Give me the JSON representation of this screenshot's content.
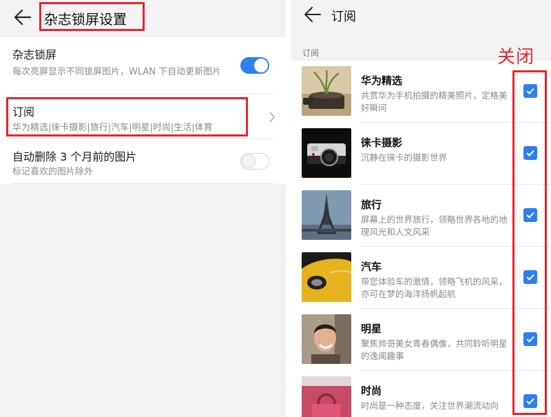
{
  "left": {
    "title": "杂志锁屏设置",
    "settings": [
      {
        "title": "杂志锁屏",
        "subtitle": "每次亮屏显示不同锁屏图片，WLAN 下自动更新图片",
        "toggle": true
      },
      {
        "title": "订阅",
        "subtitle": "华为精选|徕卡摄影|旅行|汽车|明星|时尚|生活|体育"
      },
      {
        "title": "自动删除 3 个月前的图片",
        "subtitle": "标记喜欢的图片除外",
        "toggle": false
      }
    ]
  },
  "right": {
    "title": "订阅",
    "section_label": "订阅",
    "annotation": "关闭",
    "items": [
      {
        "title": "华为精选",
        "desc": "共赏华为手机拍摄的精美照片，定格美好瞬间",
        "checked": true
      },
      {
        "title": "徕卡摄影",
        "desc": "沉静在徕卡的摄影世界",
        "checked": true
      },
      {
        "title": "旅行",
        "desc": "屏幕上的世界旅行，领略世界各地的地理风光和人文风采",
        "checked": true
      },
      {
        "title": "汽车",
        "desc": "带您体验车的激情，领略飞机的风采，亦可在梦的海洋扬帆起航",
        "checked": true
      },
      {
        "title": "明星",
        "desc": "聚焦帅哥美女青春偶像，共同聆听明星的逸闻趣事",
        "checked": true
      },
      {
        "title": "时尚",
        "desc": "时尚是一种态度，关注世界潮流动向",
        "checked": true
      }
    ]
  },
  "colors": {
    "accent": "#2d7ff0",
    "annotation_red": "#e8242c"
  }
}
